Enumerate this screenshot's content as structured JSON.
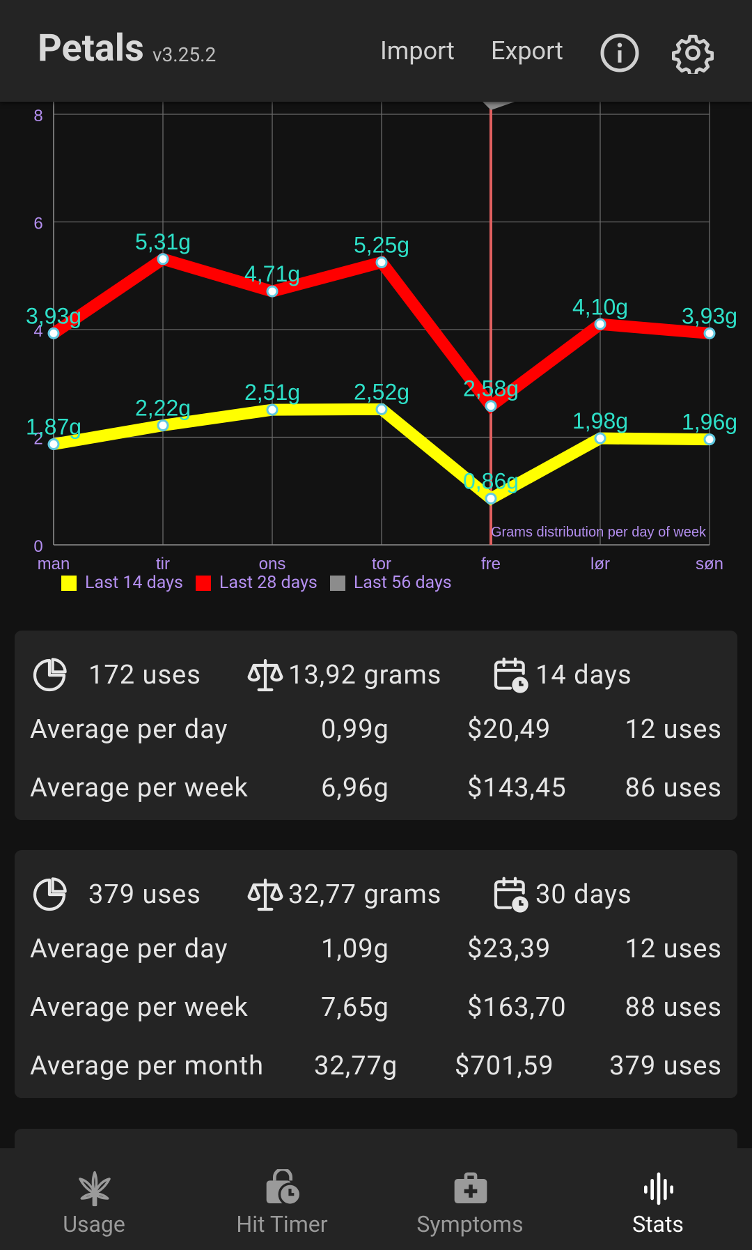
{
  "app": {
    "title": "Petals",
    "version": "v3.25.2"
  },
  "toolbar": {
    "import_label": "Import",
    "export_label": "Export",
    "info_icon": "info-icon",
    "settings_icon": "gear-icon"
  },
  "chart_data": {
    "type": "line",
    "title": "Grams distribution per day of week",
    "categories": [
      "man",
      "tir",
      "ons",
      "tor",
      "fre",
      "lør",
      "søn"
    ],
    "y_ticks": [
      "0",
      "2",
      "4",
      "6",
      "8"
    ],
    "ylim": [
      0,
      8
    ],
    "grid": true,
    "legend_position": "bottom-left",
    "highlighted_category": "fre",
    "series": [
      {
        "name": "Last 14 days",
        "color": "#ffff00",
        "values": [
          1.87,
          2.22,
          2.51,
          2.52,
          0.86,
          1.98,
          1.96
        ],
        "labels": [
          "1,87g",
          "2,22g",
          "2,51g",
          "2,52g",
          "0,86g",
          "1,98g",
          "1,96g"
        ]
      },
      {
        "name": "Last 28 days",
        "color": "#ff0000",
        "values": [
          3.93,
          5.31,
          4.71,
          5.25,
          2.58,
          4.1,
          3.93
        ],
        "labels": [
          "3,93g",
          "5,31g",
          "4,71g",
          "5,25g",
          "2,58g",
          "4,10g",
          "3,93g"
        ]
      },
      {
        "name": "Last 56 days",
        "color": "#8c8c8c",
        "values": [],
        "labels": []
      }
    ]
  },
  "cards": [
    {
      "uses": "172 uses",
      "grams": "13,92 grams",
      "days": "14 days",
      "rows": [
        {
          "label": "Average per day",
          "grams": "0,99g",
          "money": "$20,49",
          "uses": "12 uses"
        },
        {
          "label": "Average per week",
          "grams": "6,96g",
          "money": "$143,45",
          "uses": "86 uses"
        }
      ]
    },
    {
      "uses": "379 uses",
      "grams": "32,77 grams",
      "days": "30 days",
      "rows": [
        {
          "label": "Average per day",
          "grams": "1,09g",
          "money": "$23,39",
          "uses": "12 uses"
        },
        {
          "label": "Average per week",
          "grams": "7,65g",
          "money": "$163,70",
          "uses": "88 uses"
        },
        {
          "label": "Average per month",
          "grams": "32,77g",
          "money": "$701,59",
          "uses": "379 uses"
        }
      ]
    }
  ],
  "nav": [
    {
      "label": "Usage",
      "icon": "leaf-icon",
      "active": false
    },
    {
      "label": "Hit Timer",
      "icon": "timer-icon",
      "active": false
    },
    {
      "label": "Symptoms",
      "icon": "medkit-icon",
      "active": false
    },
    {
      "label": "Stats",
      "icon": "stats-icon",
      "active": true
    }
  ]
}
